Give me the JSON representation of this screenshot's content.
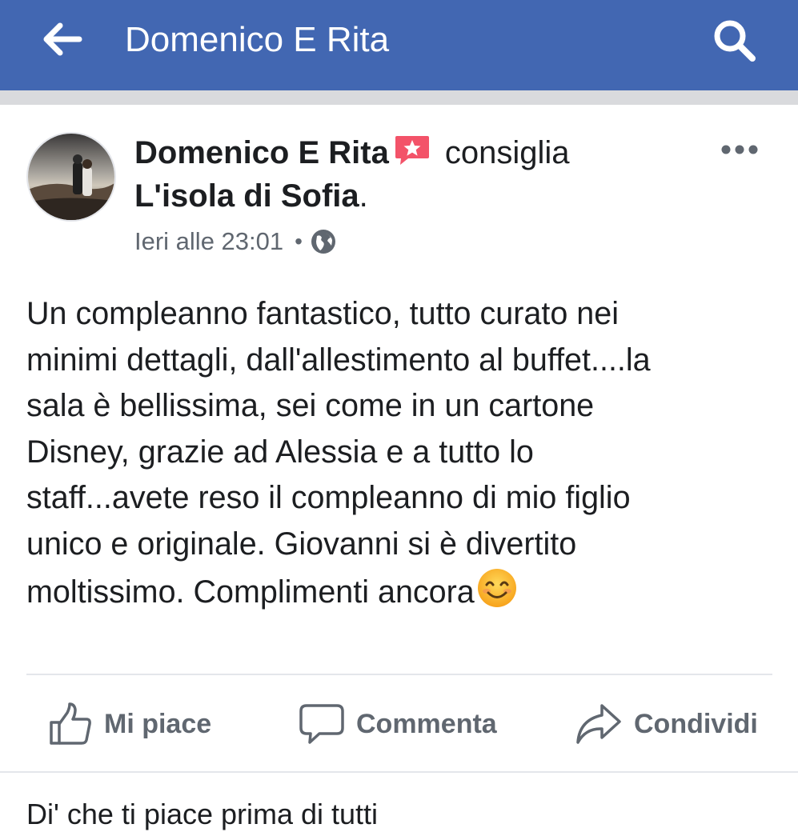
{
  "header": {
    "title": "Domenico E Rita",
    "back_icon": "arrow-left-icon",
    "search_icon": "search-icon",
    "bar_color": "#4267b2"
  },
  "post": {
    "author": "Domenico E Rita",
    "recommend_icon": "recommendation-star-icon",
    "action": "consiglia",
    "page_name": "L'isola di Sofia",
    "page_suffix": ".",
    "timestamp": "Ieri alle 23:01",
    "separator": "•",
    "privacy_icon": "globe-icon",
    "more_icon": "more-options-icon",
    "text_lines": [
      "Un compleanno fantastico, tutto curato nei",
      "minimi dettagli, dall'allestimento al buffet....la",
      "sala è bellissima, sei come in un cartone",
      "Disney, grazie ad Alessia e a tutto lo",
      "staff...avete reso il compleanno di mio figlio",
      "unico e originale. Giovanni si è divertito",
      "moltissimo. Complimenti ancora"
    ],
    "emoji": "smiling-face-icon"
  },
  "actions": {
    "like": "Mi piace",
    "comment": "Commenta",
    "share": "Condividi"
  },
  "footer": {
    "first_like_text": "Di' che ti piace prima di tutti"
  }
}
